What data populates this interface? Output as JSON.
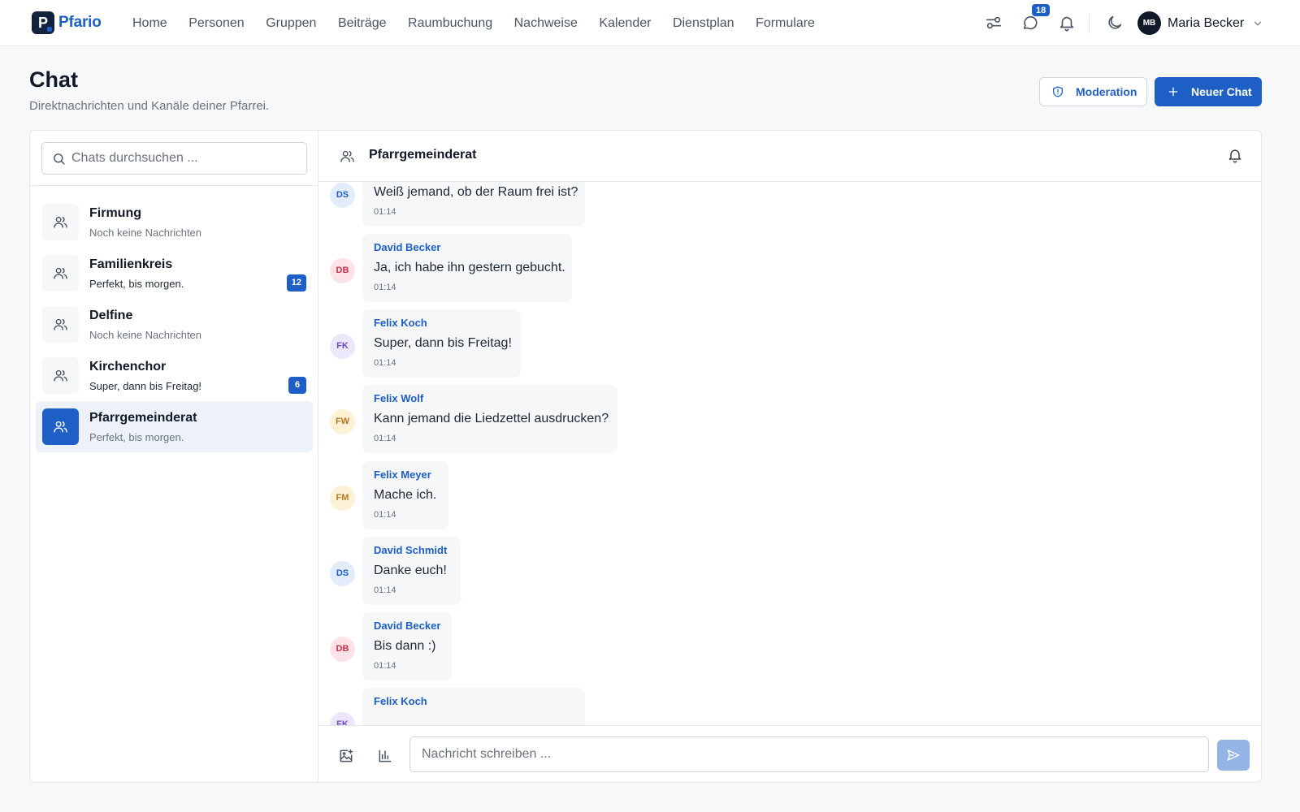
{
  "brand": {
    "mark": "P",
    "name": "Pfario"
  },
  "nav": {
    "items": [
      "Home",
      "Personen",
      "Gruppen",
      "Beiträge",
      "Raumbuchung",
      "Nachweise",
      "Kalender",
      "Dienstplan",
      "Formulare"
    ],
    "chat_badge": "18",
    "user": {
      "initials": "MB",
      "name": "Maria Becker"
    },
    "icons": [
      "filter-sliders-icon",
      "chat-bubble-icon",
      "bell-icon",
      "moon-icon",
      "chevron-down-icon"
    ]
  },
  "header": {
    "title": "Chat",
    "subtitle": "Direktnachrichten und Kanäle deiner Pfarrei.",
    "moderation_label": "Moderation",
    "new_chat_label": "Neuer Chat"
  },
  "sidebar": {
    "search_placeholder": "Chats durchsuchen ...",
    "chats": [
      {
        "name": "Firmung",
        "preview": "Noch keine Nachrichten",
        "badge": null,
        "active": false
      },
      {
        "name": "Familienkreis",
        "preview": "Perfekt, bis morgen.",
        "badge": "12",
        "active": false
      },
      {
        "name": "Delfine",
        "preview": "Noch keine Nachrichten",
        "badge": null,
        "active": false
      },
      {
        "name": "Kirchenchor",
        "preview": "Super, dann bis Freitag!",
        "badge": "6",
        "active": false
      },
      {
        "name": "Pfarrgemeinderat",
        "preview": "Perfekt, bis morgen.",
        "badge": null,
        "active": true
      }
    ]
  },
  "conversation": {
    "title": "Pfarrgemeinderat",
    "messages": [
      {
        "initials": "DS",
        "sender": "",
        "text": "Weiß jemand, ob der Raum frei ist?",
        "time": "01:14",
        "avatar_bg": "#e3ecfa",
        "avatar_fg": "#1d5fc4"
      },
      {
        "initials": "DB",
        "sender": "David Becker",
        "text": "Ja, ich habe ihn gestern gebucht.",
        "time": "01:14",
        "avatar_bg": "#fde3e7",
        "avatar_fg": "#c2334d"
      },
      {
        "initials": "FK",
        "sender": "Felix Koch",
        "text": "Super, dann bis Freitag!",
        "time": "01:14",
        "avatar_bg": "#ede7fb",
        "avatar_fg": "#6d4bc9"
      },
      {
        "initials": "FW",
        "sender": "Felix Wolf",
        "text": "Kann jemand die Liedzettel ausdrucken?",
        "time": "01:14",
        "avatar_bg": "#fdf1d6",
        "avatar_fg": "#b7791f"
      },
      {
        "initials": "FM",
        "sender": "Felix Meyer",
        "text": "Mache ich.",
        "time": "01:14",
        "avatar_bg": "#fdf1d6",
        "avatar_fg": "#b7791f"
      },
      {
        "initials": "DS",
        "sender": "David Schmidt",
        "text": "Danke euch!",
        "time": "01:14",
        "avatar_bg": "#e3ecfa",
        "avatar_fg": "#1d5fc4"
      },
      {
        "initials": "DB",
        "sender": "David Becker",
        "text": "Bis dann :)",
        "time": "01:14",
        "avatar_bg": "#fde3e7",
        "avatar_fg": "#c2334d"
      },
      {
        "initials": "FK",
        "sender": "Felix Koch",
        "text": "",
        "time": "",
        "avatar_bg": "#ede7fb",
        "avatar_fg": "#6d4bc9"
      }
    ],
    "composer_placeholder": "Nachricht schreiben ..."
  },
  "colors": {
    "accent": "#1d5fc4",
    "send_disabled": "#93b4e4",
    "active_row": "#edf2fa"
  }
}
